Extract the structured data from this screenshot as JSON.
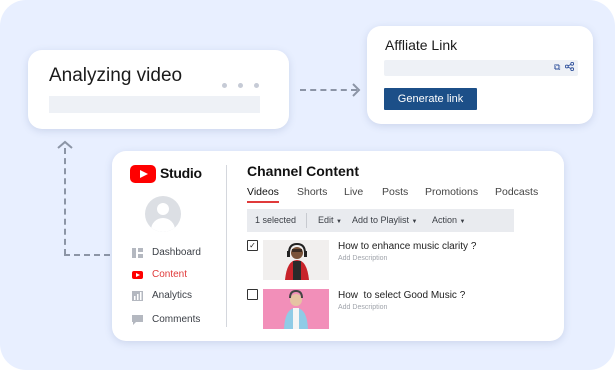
{
  "analyzing": {
    "title": "Analyzing video"
  },
  "affiliate": {
    "title": "Affliate Link",
    "button": "Generate link",
    "copy_icon": "copy-icon",
    "share_icon": "share-icon"
  },
  "studio": {
    "logo_text": "Studio",
    "nav": [
      {
        "label": "Dashboard",
        "icon": "dashboard-icon"
      },
      {
        "label": "Content",
        "icon": "youtube-play-icon",
        "active": true
      },
      {
        "label": "Analytics",
        "icon": "analytics-icon"
      },
      {
        "label": "Comments",
        "icon": "comments-icon"
      }
    ],
    "content_title": "Channel Content",
    "tabs": [
      "Videos",
      "Shorts",
      "Live",
      "Posts",
      "Promotions",
      "Podcasts"
    ],
    "toolbar": {
      "selected": "1 selected",
      "edit": "Edit",
      "add_to_playlist": "Add to Playlist",
      "action": "Action"
    },
    "videos": [
      {
        "title": "How to enhance music clarity ?",
        "description": "Add Description",
        "checked": true
      },
      {
        "title": "How  to select Good Music ?",
        "description": "Add Description",
        "checked": false
      }
    ]
  },
  "colors": {
    "accent": "#1c4f88",
    "brand_red": "#ff0000",
    "background": "#e8efff"
  }
}
